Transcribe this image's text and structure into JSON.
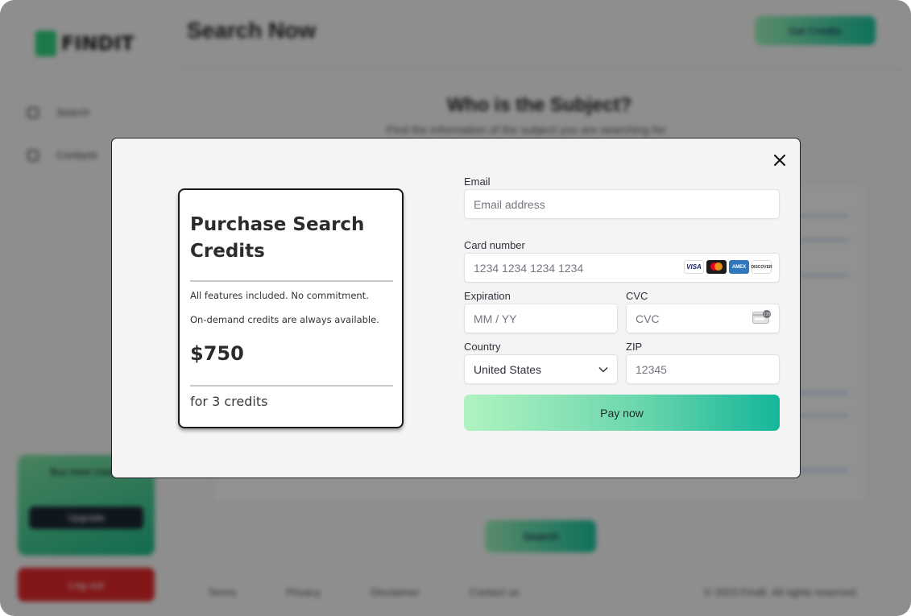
{
  "background": {
    "logo_text": "FINDIT",
    "page_title": "Search Now",
    "top_button_label": "Get Credits",
    "nav_items": [
      "Search",
      "Contacts"
    ],
    "heading": "Who is the Subject?",
    "subheading": "Find the information of the subject you are searching for.",
    "search_button_label": "Search",
    "promo_text": "Buy more credits",
    "promo_button_label": "Upgrade",
    "logout_label": "Log out",
    "footer_links": [
      "Terms",
      "Privacy",
      "Disclaimer",
      "Contact us"
    ],
    "footer_right": "© 2023 Findit. All rights reserved."
  },
  "modal": {
    "summary": {
      "title": "Purchase Search Credits",
      "line1": "All features included. No commitment.",
      "line2": "On-demand credits are always available.",
      "price": "$750",
      "credits_text": "for 3 credits"
    },
    "form": {
      "email_label": "Email",
      "email_placeholder": "Email address",
      "card_label": "Card number",
      "card_placeholder": "1234 1234 1234 1234",
      "card_brands": [
        "VISA",
        "mastercard",
        "AMEX",
        "DISCOVER"
      ],
      "expiration_label": "Expiration",
      "expiration_placeholder": "MM / YY",
      "cvc_label": "CVC",
      "cvc_placeholder": "CVC",
      "cvc_icon_text": "135",
      "country_label": "Country",
      "country_value": "United States",
      "zip_label": "ZIP",
      "zip_placeholder": "12345",
      "pay_label": "Pay now"
    },
    "icons": {
      "close": "close-icon",
      "chevron": "chevron-down-icon",
      "cvc": "card-cvc-icon"
    }
  }
}
